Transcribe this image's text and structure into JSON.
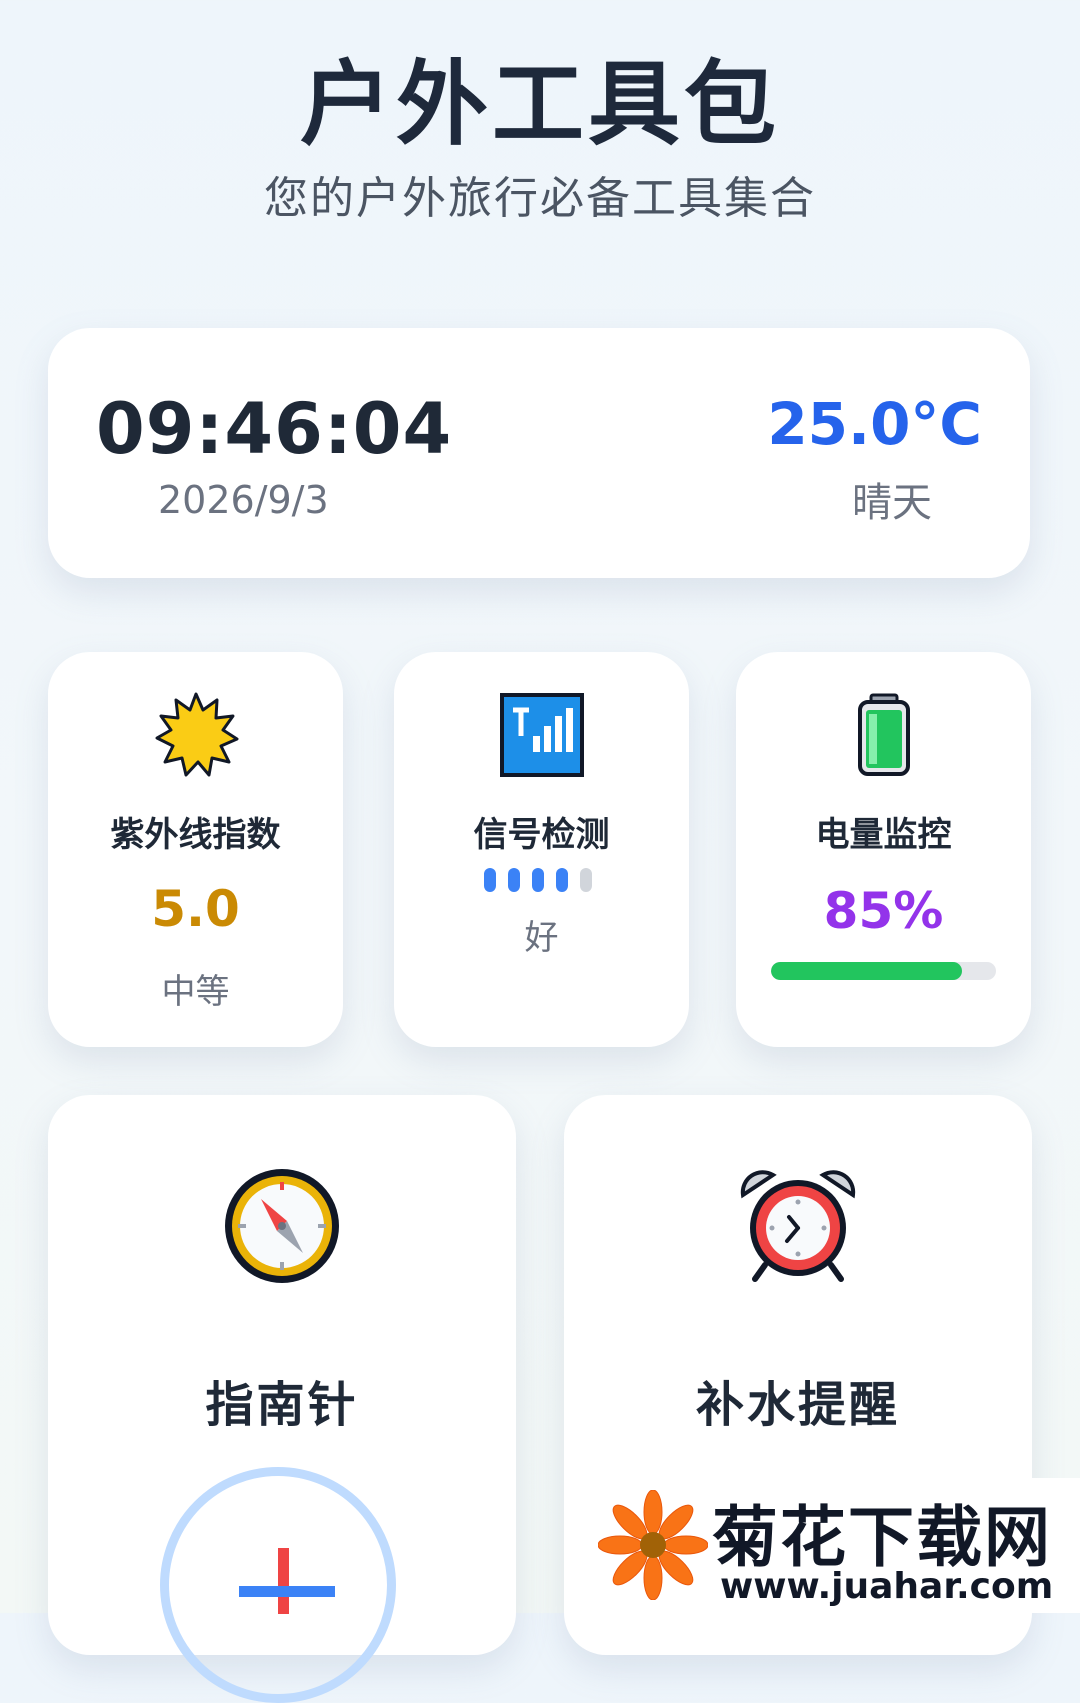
{
  "header": {
    "title": "户外工具包",
    "subtitle": "您的户外旅行必备工具集合"
  },
  "status": {
    "time": "09:46:04",
    "date": "2026/9/3",
    "temperature": "25.0°C",
    "weather": "晴天"
  },
  "tools": {
    "uv": {
      "icon": "sun-icon",
      "label": "紫外线指数",
      "value": "5.0",
      "level": "中等"
    },
    "signal": {
      "icon": "signal-icon",
      "label": "信号检测",
      "bars_active": 4,
      "bars_total": 5,
      "status": "好"
    },
    "battery": {
      "icon": "battery-icon",
      "label": "电量监控",
      "percent_text": "85%",
      "level_fraction": 0.85
    },
    "compass": {
      "icon": "compass-icon",
      "label": "指南针"
    },
    "hydration": {
      "icon": "alarm-clock-icon",
      "label": "补水提醒"
    }
  },
  "watermark": {
    "name": "菊花下载网",
    "url": "www.juahar.com"
  },
  "colors": {
    "temperature": "#2563eb",
    "uv_value": "#ca8a04",
    "battery_value": "#9333ea",
    "battery_fill": "#22c55e",
    "signal_bar": "#3b82f6"
  }
}
